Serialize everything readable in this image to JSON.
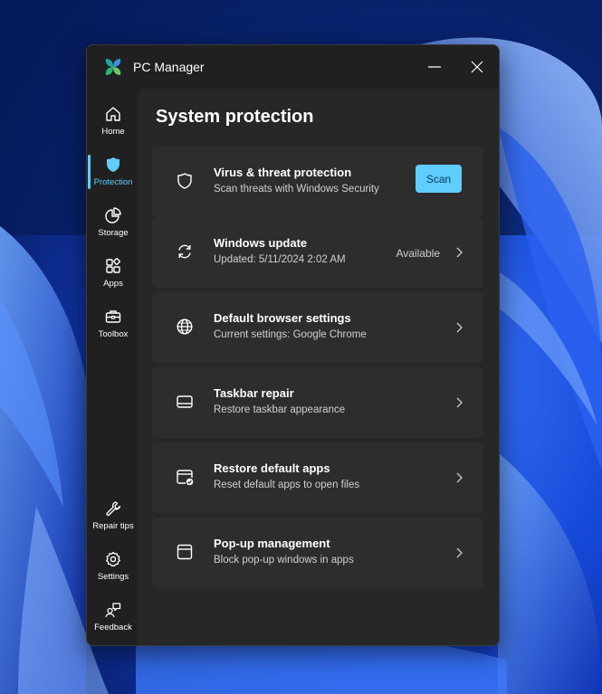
{
  "window": {
    "title": "PC Manager",
    "accent": "#60cdff"
  },
  "titlebar": {
    "minimize_icon": "minimize-icon",
    "close_icon": "close-icon"
  },
  "sidebar": {
    "items": [
      {
        "label": "Home",
        "icon": "home-icon"
      },
      {
        "label": "Protection",
        "icon": "shield-icon",
        "active": true
      },
      {
        "label": "Storage",
        "icon": "pie-chart-icon"
      },
      {
        "label": "Apps",
        "icon": "apps-icon"
      },
      {
        "label": "Toolbox",
        "icon": "toolbox-icon"
      }
    ],
    "bottom_items": [
      {
        "label": "Repair tips",
        "icon": "wrench-icon"
      },
      {
        "label": "Settings",
        "icon": "gear-icon"
      },
      {
        "label": "Feedback",
        "icon": "feedback-icon"
      }
    ]
  },
  "main": {
    "title": "System protection",
    "cards": [
      {
        "title": "Virus & threat protection",
        "subtitle": "Scan threats with Windows Security",
        "icon": "shield-outline-icon",
        "button": "Scan"
      },
      {
        "title": "Windows update",
        "subtitle": "Updated: 5/11/2024 2:02 AM",
        "icon": "sync-icon",
        "status": "Available"
      },
      {
        "title": "Default browser settings",
        "subtitle": "Current settings: Google Chrome",
        "icon": "globe-icon"
      },
      {
        "title": "Taskbar repair",
        "subtitle": "Restore taskbar appearance",
        "icon": "taskbar-icon"
      },
      {
        "title": "Restore default apps",
        "subtitle": "Reset default apps to open files",
        "icon": "app-check-icon"
      },
      {
        "title": "Pop-up management",
        "subtitle": "Block pop-up windows in apps",
        "icon": "window-icon"
      }
    ]
  }
}
